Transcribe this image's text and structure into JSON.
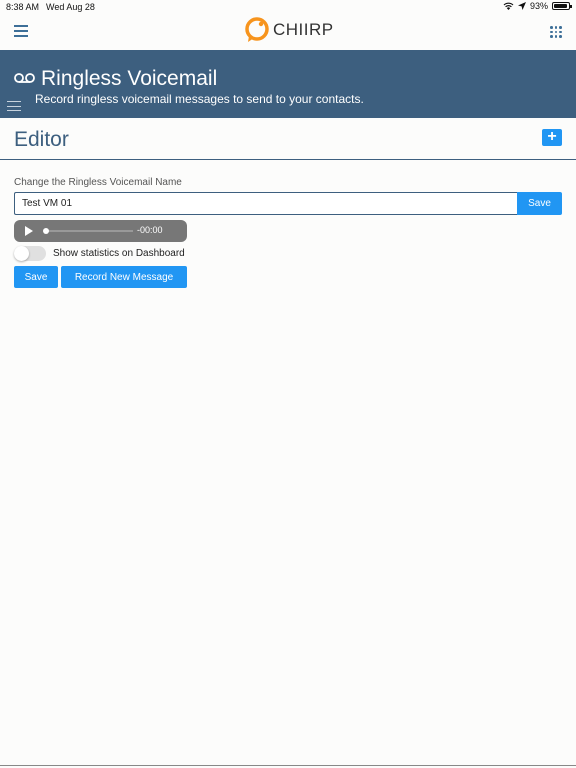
{
  "status_bar": {
    "time": "8:38 AM",
    "date": "Wed Aug 28",
    "battery": "93%"
  },
  "topnav": {
    "brand": "CHIIRP",
    "brand_color": "#f7941d"
  },
  "banner": {
    "title": "Ringless Voicemail",
    "subtitle": "Record ringless voicemail messages to send to your contacts.",
    "background": "#3d5f7f"
  },
  "editor": {
    "title": "Editor",
    "add_label": "+"
  },
  "form": {
    "name_label": "Change the Ringless Voicemail Name",
    "name_value": "Test VM 01",
    "save_inline_label": "Save"
  },
  "audio": {
    "time": "-00:00",
    "progress": 0
  },
  "toggle": {
    "label": "Show statistics on Dashboard",
    "on": false
  },
  "actions": {
    "save_label": "Save",
    "record_label": "Record New Message"
  },
  "colors": {
    "accent": "#2196f3",
    "primary": "#3d5f7f"
  }
}
